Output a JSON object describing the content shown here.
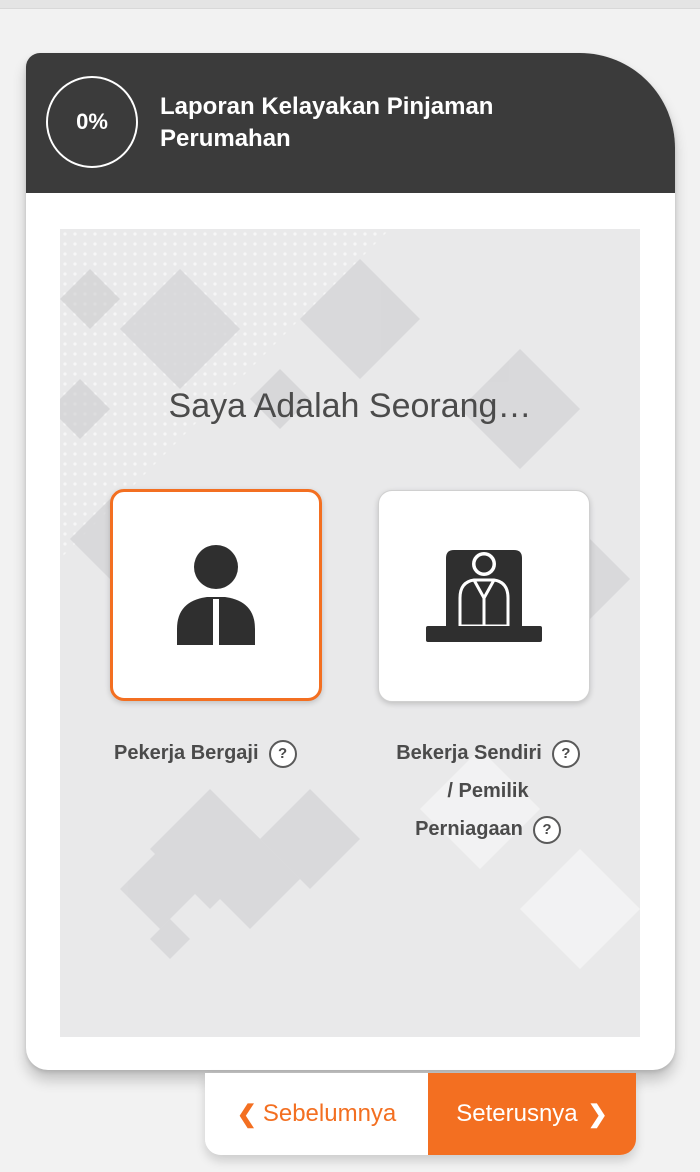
{
  "header": {
    "progress": "0%",
    "title": "Laporan Kelayakan Pinjaman Perumahan"
  },
  "main": {
    "question": "Saya Adalah Seorang…",
    "options": [
      {
        "label": "Pekerja Bergaji",
        "help": "?",
        "icon": "salaried-employee-icon",
        "selected": true
      },
      {
        "label_line1": "Bekerja Sendiri",
        "label_line2": "/ Pemilik",
        "label_line3": "Perniagaan",
        "help": "?",
        "icon": "business-owner-icon",
        "selected": false
      }
    ]
  },
  "nav": {
    "prev_label": "Sebelumnya",
    "next_label": "Seterusnya",
    "prev_chevron": "❮",
    "next_chevron": "❯"
  },
  "colors": {
    "accent": "#f36f21",
    "header_bg": "#3b3b3b",
    "text": "#4b4b4b"
  }
}
